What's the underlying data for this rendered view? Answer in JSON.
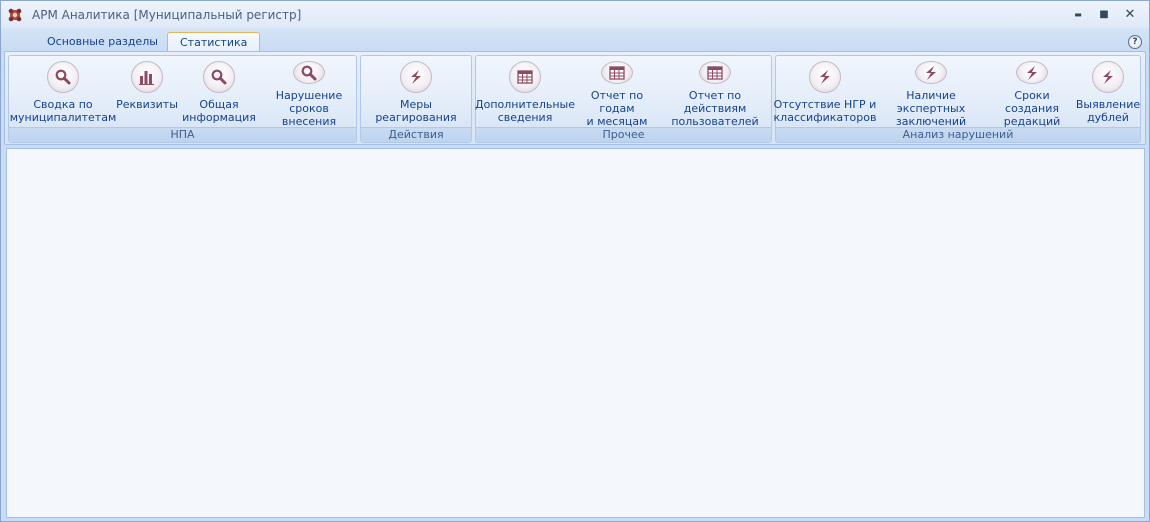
{
  "window": {
    "title": "АРМ Аналитика [Муниципальный регистр]",
    "icons": {
      "app": "app-logo-icon",
      "minimize": "minimize-icon",
      "maximize": "maximize-icon",
      "close": "close-icon"
    },
    "controls": {
      "minimize": "▬",
      "maximize": "■",
      "close": "✕"
    }
  },
  "tabs": [
    {
      "label": "Основные разделы",
      "active": false
    },
    {
      "label": "Статистика",
      "active": true
    }
  ],
  "help": {
    "label": "?"
  },
  "ribbon": {
    "groups": [
      {
        "label": "НПА",
        "buttons": [
          {
            "label": "Сводка по\nмуниципалитетам",
            "icon": "search-icon"
          },
          {
            "label": "Реквизиты",
            "icon": "bar-chart-icon"
          },
          {
            "label": "Общая\nинформация",
            "icon": "search-icon"
          },
          {
            "label": "Нарушение\nсроков внесения",
            "icon": "search-icon"
          }
        ]
      },
      {
        "label": "Действия",
        "buttons": [
          {
            "label": "Меры реагирования",
            "icon": "lightning-icon"
          }
        ]
      },
      {
        "label": "Прочее",
        "buttons": [
          {
            "label": "Дополнительные\nсведения",
            "icon": "table-icon"
          },
          {
            "label": "Отчет по годам\nи месяцам",
            "icon": "table-icon"
          },
          {
            "label": "Отчет по действиям\nпользователей",
            "icon": "table-icon"
          }
        ]
      },
      {
        "label": "Анализ нарушений",
        "buttons": [
          {
            "label": "Отсутствие НГР и\nклассификаторов",
            "icon": "lightning-icon"
          },
          {
            "label": "Наличие экспертных\nзаключений",
            "icon": "lightning-icon"
          },
          {
            "label": "Сроки создания\nредакций",
            "icon": "lightning-icon"
          },
          {
            "label": "Выявление\nдублей",
            "icon": "lightning-icon"
          }
        ]
      }
    ]
  },
  "colors": {
    "accent": "#15428b",
    "ribbon_bg": "#dfeaf8",
    "tab_active_border": "#e3b657",
    "icon_glyph": "#8d4a62"
  }
}
